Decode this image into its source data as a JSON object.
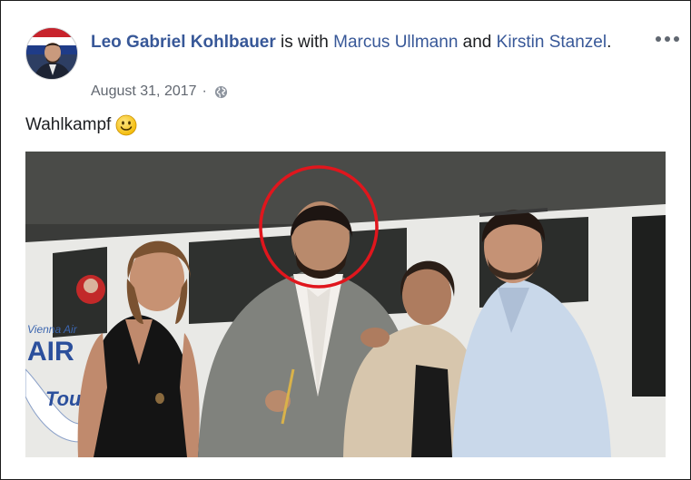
{
  "post": {
    "author": "Leo Gabriel Kohlbauer",
    "with_text": " is with ",
    "tagged_1": "Marcus Ullmann",
    "and_text": " and ",
    "tagged_2": "Kirstin Stanzel",
    "period": ".",
    "date": "August 31, 2017",
    "separator": "·",
    "privacy_icon": "globe-icon",
    "text": "Wahlkampf",
    "emoji": "smiley-emoji",
    "more_icon": "more-options-icon"
  },
  "photo": {
    "van_text_top": "Vienna Air",
    "van_text_big": "AIR",
    "van_text_tour": "Tou",
    "highlight_color": "#e0161d"
  },
  "colors": {
    "link": "#385898",
    "meta": "#616770"
  }
}
